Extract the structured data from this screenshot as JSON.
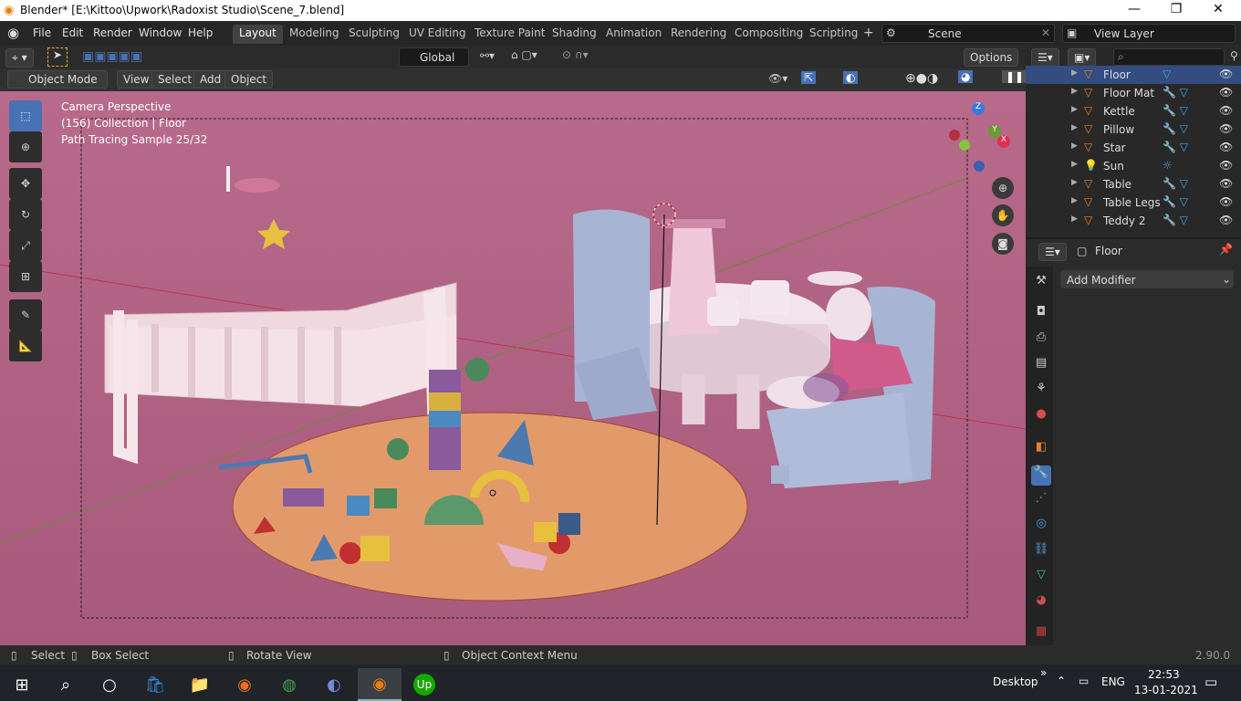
{
  "window": {
    "title": "Blender* [E:\\Kittoo\\Upwork\\Radoxist Studio\\Scene_7.blend]",
    "minimize": "—",
    "maximize": "❐",
    "close": "✕"
  },
  "menu": [
    "File",
    "Edit",
    "Render",
    "Window",
    "Help"
  ],
  "workspaces": [
    "Layout",
    "Modeling",
    "Sculpting",
    "UV Editing",
    "Texture Paint",
    "Shading",
    "Animation",
    "Rendering",
    "Compositing",
    "Scripting"
  ],
  "active_workspace": "Layout",
  "scene": {
    "label": "Scene",
    "view_layer": "View Layer"
  },
  "header": {
    "orientation": "Global",
    "options": "Options"
  },
  "viewport_header": {
    "mode": "Object Mode",
    "items": [
      "View",
      "Select",
      "Add",
      "Object"
    ]
  },
  "overlay_text": {
    "line1": "Camera Perspective",
    "line2": "(156) Collection | Floor",
    "line3": "Path Tracing Sample 25/32"
  },
  "gizmo": {
    "x": "X",
    "y": "Y",
    "z": "Z"
  },
  "outliner": {
    "items": [
      "Floor",
      "Floor Mat",
      "Kettle",
      "Pillow",
      "Star",
      "Sun",
      "Table",
      "Table Legs",
      "Teddy 2"
    ],
    "selected": "Floor"
  },
  "properties": {
    "object": "Floor",
    "add_modifier": "Add Modifier"
  },
  "status": {
    "select": "Select",
    "box_select": "Box Select",
    "rotate": "Rotate View",
    "context": "Object Context Menu",
    "version": "2.90.0"
  },
  "taskbar": {
    "desktop": "Desktop",
    "lang": "ENG",
    "time": "22:53",
    "date": "13-01-2021",
    "chevron": "»"
  },
  "colors": {
    "accent": "#4772b3",
    "viewport_bg": "#a8607f",
    "floor_rug": "#e8a06a",
    "selected_row": "#334d80"
  }
}
